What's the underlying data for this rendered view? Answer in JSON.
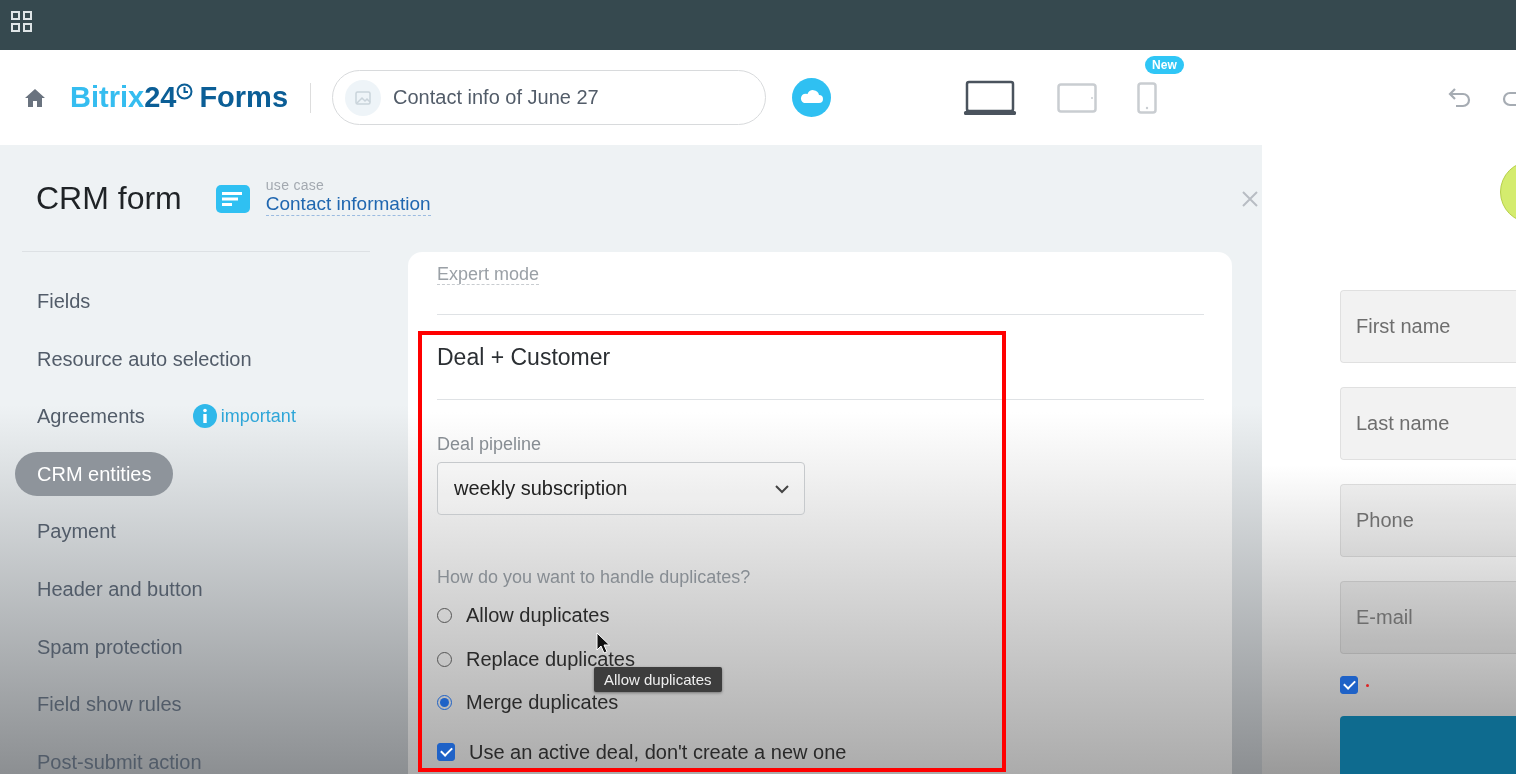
{
  "header": {
    "logo": {
      "brand": "Bitrix",
      "number": "24",
      "product": "Forms"
    },
    "form_name": "Contact info of June 27",
    "devices": [
      {
        "kind": "laptop",
        "selected": true
      },
      {
        "kind": "tablet",
        "selected": false
      },
      {
        "kind": "phone",
        "selected": false,
        "badge": "New"
      }
    ]
  },
  "panel": {
    "title": "CRM form",
    "use_case_label": "use case",
    "use_case": "Contact information"
  },
  "sidebar": {
    "items": [
      {
        "label": "Fields",
        "selected": false
      },
      {
        "label": "Resource auto selection",
        "selected": false
      },
      {
        "label": "Agreements",
        "selected": false,
        "note": "important"
      },
      {
        "label": "CRM entities",
        "selected": true
      },
      {
        "label": "Payment",
        "selected": false
      },
      {
        "label": "Header and button",
        "selected": false
      },
      {
        "label": "Spam protection",
        "selected": false
      },
      {
        "label": "Field show rules",
        "selected": false
      },
      {
        "label": "Post-submit action",
        "selected": false
      }
    ]
  },
  "card": {
    "expert_mode": "Expert mode",
    "section_title": "Deal + Customer",
    "pipeline": {
      "label": "Deal pipeline",
      "value": "weekly subscription"
    },
    "duplicates": {
      "question": "How do you want to handle duplicates?",
      "options": [
        {
          "label": "Allow duplicates",
          "selected": false
        },
        {
          "label": "Replace duplicates",
          "selected": false
        },
        {
          "label": "Merge duplicates",
          "selected": true
        }
      ]
    },
    "active_deal": {
      "label": "Use an active deal, don't create a new one",
      "checked": true
    },
    "tooltip": "Allow duplicates"
  },
  "preview": {
    "fields": [
      {
        "placeholder": "First name"
      },
      {
        "placeholder": "Last name"
      },
      {
        "placeholder": "Phone"
      },
      {
        "placeholder": "E-mail"
      }
    ],
    "consent_checked": true
  }
}
